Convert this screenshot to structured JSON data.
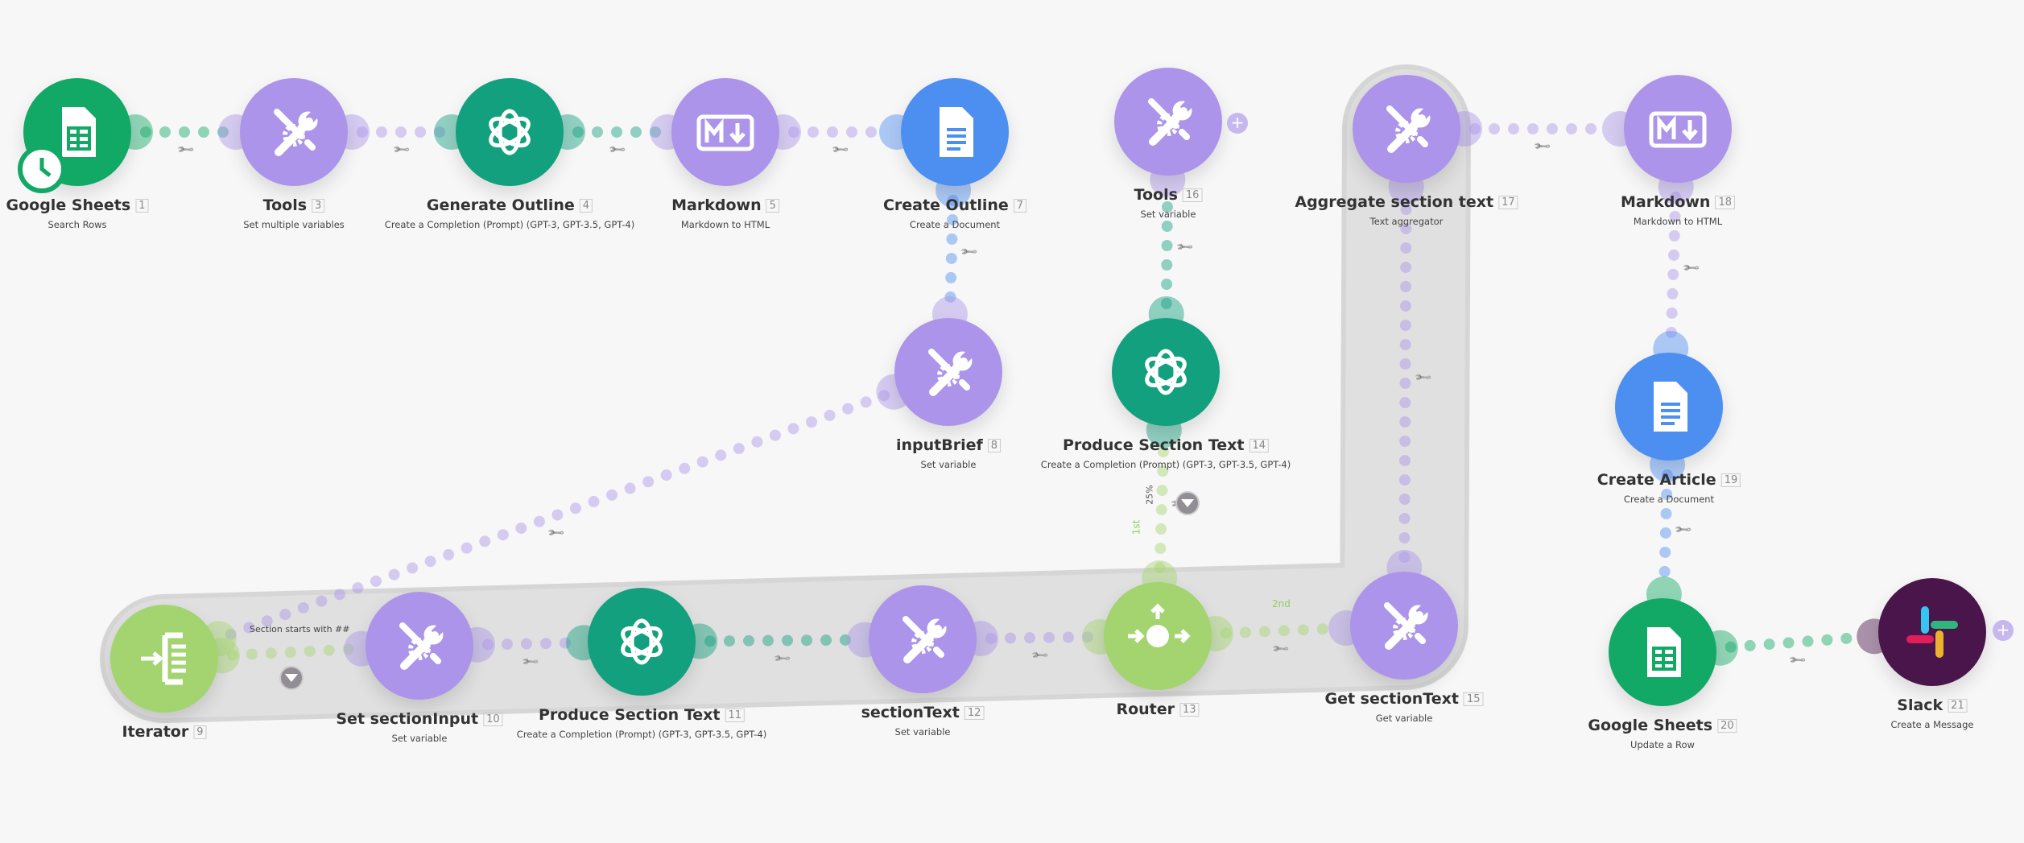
{
  "colors": {
    "sheets": "#12a865",
    "tools": "#ab94e9",
    "openai": "#12a07e",
    "markdown": "#ab94e9",
    "docs": "#4d8ff1",
    "flow": "#a3d46f",
    "slack": "#4a154b",
    "loop": "#e0e0e0"
  },
  "nodes": [
    {
      "id": "1",
      "name": "Google Sheets",
      "sub": "Search Rows",
      "icon": "sheets-icon",
      "type": "sheets"
    },
    {
      "id": "3",
      "name": "Tools",
      "sub": "Set multiple variables",
      "icon": "tools-icon",
      "type": "tools"
    },
    {
      "id": "4",
      "name": "Generate Outline",
      "sub": "Create a Completion (Prompt) (GPT-3, GPT-3.5, GPT-4)",
      "icon": "openai-icon",
      "type": "openai"
    },
    {
      "id": "5",
      "name": "Markdown",
      "sub": "Markdown to HTML",
      "icon": "markdown-icon",
      "type": "markdown"
    },
    {
      "id": "7",
      "name": "Create Outline",
      "sub": "Create a Document",
      "icon": "docs-icon",
      "type": "docs"
    },
    {
      "id": "16",
      "name": "Tools",
      "sub": "Set variable",
      "icon": "tools-icon",
      "type": "tools"
    },
    {
      "id": "17",
      "name": "Aggregate section text",
      "sub": "Text aggregator",
      "icon": "tools-icon",
      "type": "tools"
    },
    {
      "id": "18",
      "name": "Markdown",
      "sub": "Markdown to HTML",
      "icon": "markdown-icon",
      "type": "markdown"
    },
    {
      "id": "8",
      "name": "inputBrief",
      "sub": "Set variable",
      "icon": "tools-icon",
      "type": "tools"
    },
    {
      "id": "14",
      "name": "Produce Section Text",
      "sub": "Create a Completion (Prompt) (GPT-3, GPT-3.5, GPT-4)",
      "icon": "openai-icon",
      "type": "openai"
    },
    {
      "id": "19",
      "name": "Create Article",
      "sub": "Create a Document",
      "icon": "docs-icon",
      "type": "docs"
    },
    {
      "id": "9",
      "name": "Iterator",
      "sub": "",
      "icon": "iterator-icon",
      "type": "flow"
    },
    {
      "id": "10",
      "name": "Set sectionInput",
      "sub": "Set variable",
      "icon": "tools-icon",
      "type": "tools"
    },
    {
      "id": "11",
      "name": "Produce Section Text",
      "sub": "Create a Completion (Prompt) (GPT-3, GPT-3.5, GPT-4)",
      "icon": "openai-icon",
      "type": "openai"
    },
    {
      "id": "12",
      "name": "sectionText",
      "sub": "Set variable",
      "icon": "tools-icon",
      "type": "tools"
    },
    {
      "id": "13",
      "name": "Router",
      "sub": "",
      "icon": "router-icon",
      "type": "flow"
    },
    {
      "id": "15",
      "name": "Get sectionText",
      "sub": "Get variable",
      "icon": "tools-icon",
      "type": "tools"
    },
    {
      "id": "20",
      "name": "Google Sheets",
      "sub": "Update a Row",
      "icon": "sheets-icon",
      "type": "sheets"
    },
    {
      "id": "21",
      "name": "Slack",
      "sub": "Create a Message",
      "icon": "slack-icon",
      "type": "slack"
    }
  ],
  "links": [
    [
      "1",
      "3"
    ],
    [
      "3",
      "4"
    ],
    [
      "4",
      "5"
    ],
    [
      "5",
      "7"
    ],
    [
      "7",
      "8"
    ],
    [
      "8",
      "9"
    ],
    [
      "9",
      "10"
    ],
    [
      "10",
      "11"
    ],
    [
      "11",
      "12"
    ],
    [
      "12",
      "13"
    ],
    [
      "13",
      "14"
    ],
    [
      "14",
      "16"
    ],
    [
      "13",
      "15"
    ],
    [
      "15",
      "17"
    ],
    [
      "17",
      "18"
    ],
    [
      "18",
      "19"
    ],
    [
      "19",
      "20"
    ],
    [
      "20",
      "21"
    ]
  ],
  "filters": {
    "iterator_filter": "Section starts with ##"
  },
  "routes": {
    "first": "1st",
    "first_pct": "25%",
    "second": "2nd"
  }
}
